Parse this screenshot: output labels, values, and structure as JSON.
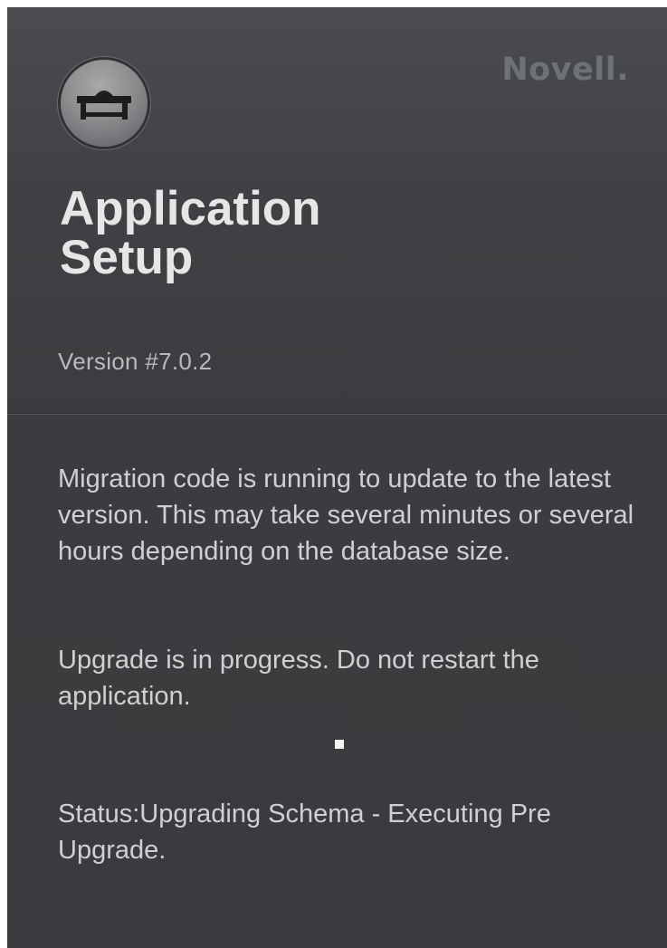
{
  "header": {
    "brand": "Novell.",
    "icon": "computer-desk-icon",
    "title_line1": "Application",
    "title_line2": "Setup",
    "version": "Version #7.0.2"
  },
  "content": {
    "migration_message": "Migration code is running to update to the latest version. This may take several minutes or several hours depending on the database size.",
    "upgrade_message": "Upgrade is in progress. Do not restart the application.",
    "status_message": "Status:Upgrading Schema - Executing Pre Upgrade."
  },
  "colors": {
    "panel_background": "#3d3f42",
    "text": "#cfd0d1",
    "title": "#e6e6e6",
    "brand": "#6f7275"
  }
}
